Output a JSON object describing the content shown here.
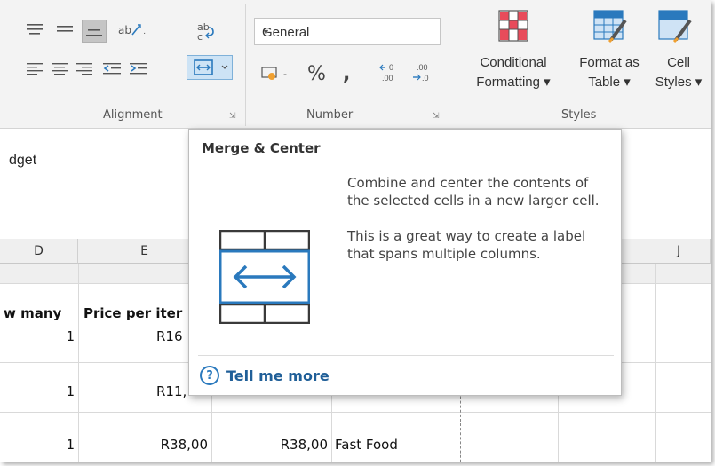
{
  "ribbon": {
    "groups": {
      "alignment": "Alignment",
      "number": "Number",
      "styles": "Styles"
    },
    "number_format": {
      "value": "General"
    },
    "styles": {
      "conditional_line1": "Conditional",
      "conditional_line2": "Formatting",
      "format_table_line1": "Format as",
      "format_table_line2": "Table",
      "cell_styles_line1": "Cell",
      "cell_styles_line2": "Styles"
    },
    "icons": [
      "align-top-icon",
      "align-middle-icon",
      "align-bottom-icon",
      "orientation-icon",
      "wrap-text-icon",
      "align-left-icon",
      "align-center-icon",
      "align-right-icon",
      "decrease-indent-icon",
      "increase-indent-icon",
      "merge-center-icon",
      "accounting-format-icon",
      "percent-icon",
      "comma-style-icon",
      "increase-decimal-icon",
      "decrease-decimal-icon",
      "conditional-formatting-icon",
      "format-as-table-icon",
      "cell-styles-icon"
    ]
  },
  "formula_bar": {
    "text": "dget"
  },
  "columns": [
    "D",
    "E",
    "J"
  ],
  "rows": {
    "header": {
      "d": "w many",
      "e": "Price per iter"
    },
    "r1": {
      "d": "1",
      "e": "R16"
    },
    "r2": {
      "d": "1",
      "e": "R11,"
    },
    "r3": {
      "d": "1",
      "e": "R38,00",
      "f": "R38,00",
      "g": "Fast Food"
    }
  },
  "tooltip": {
    "title": "Merge & Center",
    "desc1": "Combine and center the contents of the selected cells in a new larger cell.",
    "desc2": "This is a great way to create a label that spans multiple columns.",
    "help_label": "Tell me more",
    "accent": "#2a79bd"
  }
}
